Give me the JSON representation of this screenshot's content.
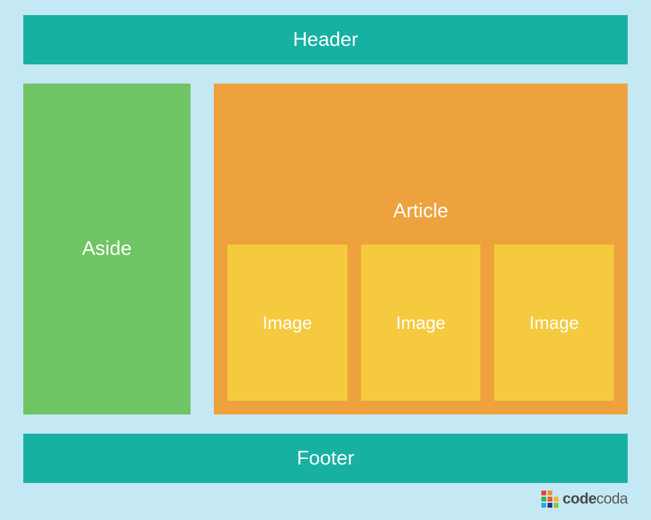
{
  "layout": {
    "header": "Header",
    "aside": "Aside",
    "article": "Article",
    "images": [
      "Image",
      "Image",
      "Image"
    ],
    "footer": "Footer"
  },
  "brand": {
    "name_prefix": "code",
    "name_suffix": "coda",
    "logo_colors": [
      "#ef4136",
      "#f7941d",
      "transparent",
      "#39b54a",
      "#f15a29",
      "#fbb040",
      "#27aae1",
      "#2e3192",
      "#8dc63f"
    ]
  },
  "colors": {
    "background": "#c5e8f5",
    "header_footer": "#17b1a4",
    "aside": "#6fc564",
    "article": "#eea23e",
    "image": "#f5ca3f"
  }
}
